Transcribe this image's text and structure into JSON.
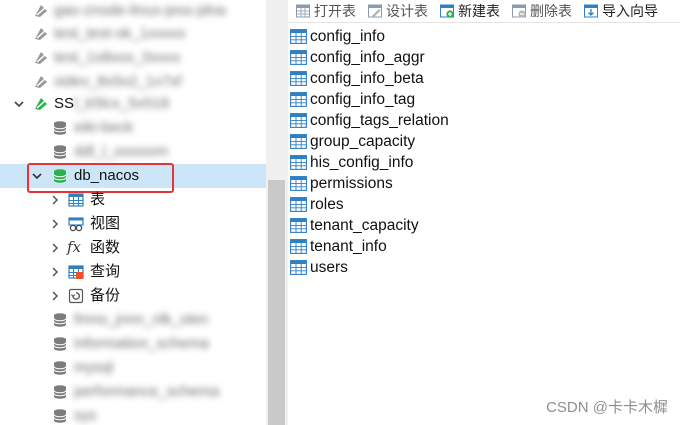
{
  "toolbar": {
    "open_label": "打开表",
    "design_label": "设计表",
    "new_label": "新建表",
    "delete_label": "删除表",
    "import_label": "导入向导"
  },
  "nav": {
    "connections": [
      {
        "label": "gao-znode-linux-jess-jdna"
      },
      {
        "label": "test_test-ok_1xxxxx"
      },
      {
        "label": "test_1x8xox_0xxxx"
      },
      {
        "label": "xidev_8x5x2_1x7xf"
      }
    ],
    "open_connection": {
      "label_prefix": "SS",
      "label_blurred": "l_k5lcx_5x518"
    },
    "databases_before": [
      {
        "label": "eiki-beck"
      },
      {
        "label": "ddl_l_ooooom"
      }
    ],
    "selected_db": {
      "label": "db_nacos"
    },
    "db_children": [
      {
        "label": "表",
        "icon": "table-icon"
      },
      {
        "label": "视图",
        "icon": "view-icon"
      },
      {
        "label": "函数",
        "icon": "function-icon"
      },
      {
        "label": "查询",
        "icon": "query-icon"
      },
      {
        "label": "备份",
        "icon": "backup-icon"
      }
    ],
    "databases_after": [
      {
        "label": "fmno_jnnn_nlk_olen"
      },
      {
        "label": "information_schema"
      },
      {
        "label": "mysql"
      },
      {
        "label": "performance_schema"
      },
      {
        "label": "sys"
      }
    ]
  },
  "tables": [
    "config_info",
    "config_info_aggr",
    "config_info_beta",
    "config_info_tag",
    "config_tags_relation",
    "group_capacity",
    "his_config_info",
    "permissions",
    "roles",
    "tenant_capacity",
    "tenant_info",
    "users"
  ],
  "watermark": "CSDN @卡卡木樨",
  "colors": {
    "selection": "#cde6f7",
    "highlight_border": "#e0353b",
    "db_open_green": "#2bb24c",
    "table_icon_blue": "#2f7fc2"
  }
}
